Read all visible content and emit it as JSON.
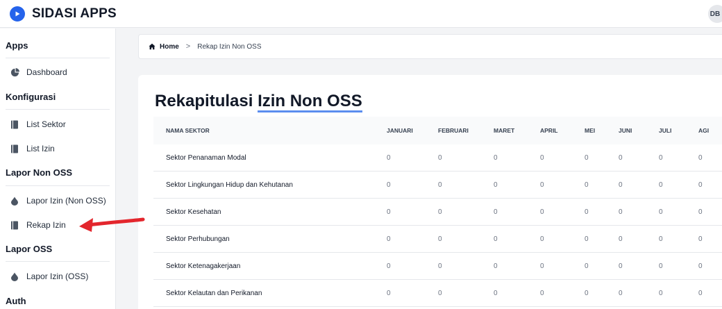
{
  "header": {
    "app_name": "SIDASI APPS",
    "avatar_initials": "DB"
  },
  "sidebar": {
    "sections": [
      {
        "title": "Apps",
        "items": [
          {
            "label": "Dashboard",
            "icon": "pie-chart-icon"
          }
        ]
      },
      {
        "title": "Konfigurasi",
        "items": [
          {
            "label": "List Sektor",
            "icon": "book-icon"
          },
          {
            "label": "List Izin",
            "icon": "book-icon"
          }
        ]
      },
      {
        "title": "Lapor Non OSS",
        "items": [
          {
            "label": "Lapor Izin (Non OSS)",
            "icon": "drop-icon"
          },
          {
            "label": "Rekap Izin",
            "icon": "book-icon"
          }
        ]
      },
      {
        "title": "Lapor OSS",
        "items": [
          {
            "label": "Lapor Izin (OSS)",
            "icon": "drop-icon"
          }
        ]
      },
      {
        "title": "Auth",
        "items": []
      }
    ]
  },
  "breadcrumb": {
    "home": "Home",
    "separator": ">",
    "current": "Rekap Izin Non OSS"
  },
  "page": {
    "title_prefix": "Rekapitulasi ",
    "title_highlight": "Izin Non OSS"
  },
  "table": {
    "columns": [
      "NAMA SEKTOR",
      "JANUARI",
      "FEBRUARI",
      "MARET",
      "APRIL",
      "MEI",
      "JUNI",
      "JULI",
      "AGI"
    ],
    "rows": [
      {
        "name": "Sektor Penanaman Modal",
        "values": [
          "0",
          "0",
          "0",
          "0",
          "0",
          "0",
          "0",
          "0"
        ]
      },
      {
        "name": "Sektor Lingkungan Hidup dan Kehutanan",
        "values": [
          "0",
          "0",
          "0",
          "0",
          "0",
          "0",
          "0",
          "0"
        ]
      },
      {
        "name": "Sektor Kesehatan",
        "values": [
          "0",
          "0",
          "0",
          "0",
          "0",
          "0",
          "0",
          "0"
        ]
      },
      {
        "name": "Sektor Perhubungan",
        "values": [
          "0",
          "0",
          "0",
          "0",
          "0",
          "0",
          "0",
          "0"
        ]
      },
      {
        "name": "Sektor Ketenagakerjaan",
        "values": [
          "0",
          "0",
          "0",
          "0",
          "0",
          "0",
          "0",
          "0"
        ]
      },
      {
        "name": "Sektor Kelautan dan Perikanan",
        "values": [
          "0",
          "0",
          "0",
          "0",
          "0",
          "0",
          "0",
          "0"
        ]
      }
    ]
  },
  "colors": {
    "brand": "#2563eb",
    "highlight_underline": "#5b8def",
    "annotation_arrow": "#e3262d"
  }
}
